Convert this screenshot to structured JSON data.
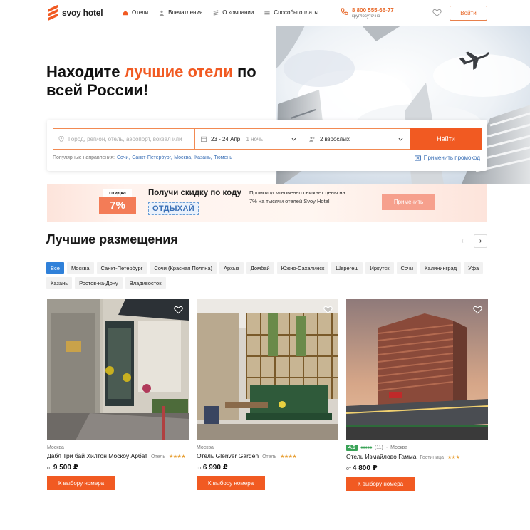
{
  "header": {
    "logo_text": "svoy hotel",
    "nav": [
      {
        "label": "Отели",
        "icon": "home-icon"
      },
      {
        "label": "Впечатления",
        "icon": "person-icon"
      },
      {
        "label": "О компании",
        "icon": "logo-s-icon"
      },
      {
        "label": "Способы оплаты",
        "icon": "card-icon"
      }
    ],
    "phone": "8 800 555-66-77",
    "phone_note": "круглосуточно",
    "login_label": "Войти"
  },
  "hero": {
    "title_part1": "Находите ",
    "title_accent": "лучшие отели",
    "title_part2": " по всей России!"
  },
  "search": {
    "where_placeholder": "Город, регион, отель, аэропорт, вокзал или",
    "dates_value": "23 - 24 Апр,",
    "dates_nights": "1 ночь",
    "guests_value": "2 взрослых",
    "find_label": "Найти",
    "popular_label": "Популярные направления:",
    "popular_cities": [
      "Сочи,",
      "Санкт-Петербург,",
      "Москва,",
      "Казань,",
      "Тюмень"
    ],
    "promo_link": "Применить промокод"
  },
  "promo": {
    "badge_top": "скидка",
    "badge_value": "7%",
    "title": "Получи скидку по коду",
    "code": "ОТДЫХАЙ",
    "description": "Промокод мгновенно снижает цены на 7% на тысячи отелей Svoy Hotel",
    "apply_label": "Применить"
  },
  "best": {
    "title": "Лучшие размещения",
    "prev_arrow": "‹",
    "next_arrow": "›",
    "chips": [
      "Все",
      "Москва",
      "Санкт-Петербург",
      "Сочи (Красная Поляна)",
      "Архыз",
      "Домбай",
      "Южно-Сахалинск",
      "Шерегеш",
      "Иркутск",
      "Сочи",
      "Калининград",
      "Уфа",
      "Казань",
      "Ростов-на-Дону",
      "Владивосток"
    ],
    "active_chip": "Все"
  },
  "cards": [
    {
      "location": "Москва",
      "name": "Дабл Три бай Хилтон Москоу Арбат",
      "kind": "Отель",
      "stars": "★★★★",
      "price_prefix": "от",
      "price": "9 500 ₽",
      "button": "К выбору номера"
    },
    {
      "location": "Москва",
      "name": "Отель Glenver Garden",
      "kind": "Отель",
      "stars": "★★★★",
      "price_prefix": "от",
      "price": "6 990 ₽",
      "button": "К выбору номера"
    },
    {
      "location": "Москва",
      "rating": "4.6",
      "rating_dots": "●●●●●",
      "reviews": "(11)",
      "name": "Отель Измайлово Гамма",
      "kind": "Гостиница",
      "stars": "★★★",
      "price_prefix": "от",
      "price": "4 800 ₽",
      "button": "К выбору номера"
    }
  ],
  "colors": {
    "accent": "#f15a22",
    "link": "#3a6fb5",
    "chip_active": "#2f80d9",
    "rating": "#3aa357"
  }
}
